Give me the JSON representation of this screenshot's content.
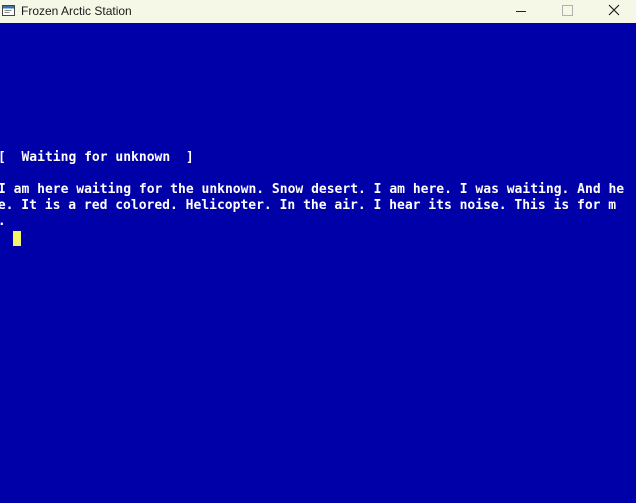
{
  "window": {
    "title": "Frozen Arctic Station",
    "icons": {
      "app": "window-icon",
      "minimize": "minimize-icon",
      "maximize": "maximize-icon",
      "close": "close-icon"
    }
  },
  "console": {
    "heading": "[  Waiting for unknown  ]",
    "lines": [
      "I am here waiting for the unknown. Snow desert. I am here. I was waiting. And he",
      "re. It is a red colored. Helicopter. In the air. I hear its noise. This is for m",
      "e.",
      "?"
    ],
    "colors": {
      "background": "#0000a8",
      "text": "#ffffff",
      "cursor": "#f4f56b",
      "titlebar": "#f5f8e6"
    }
  }
}
